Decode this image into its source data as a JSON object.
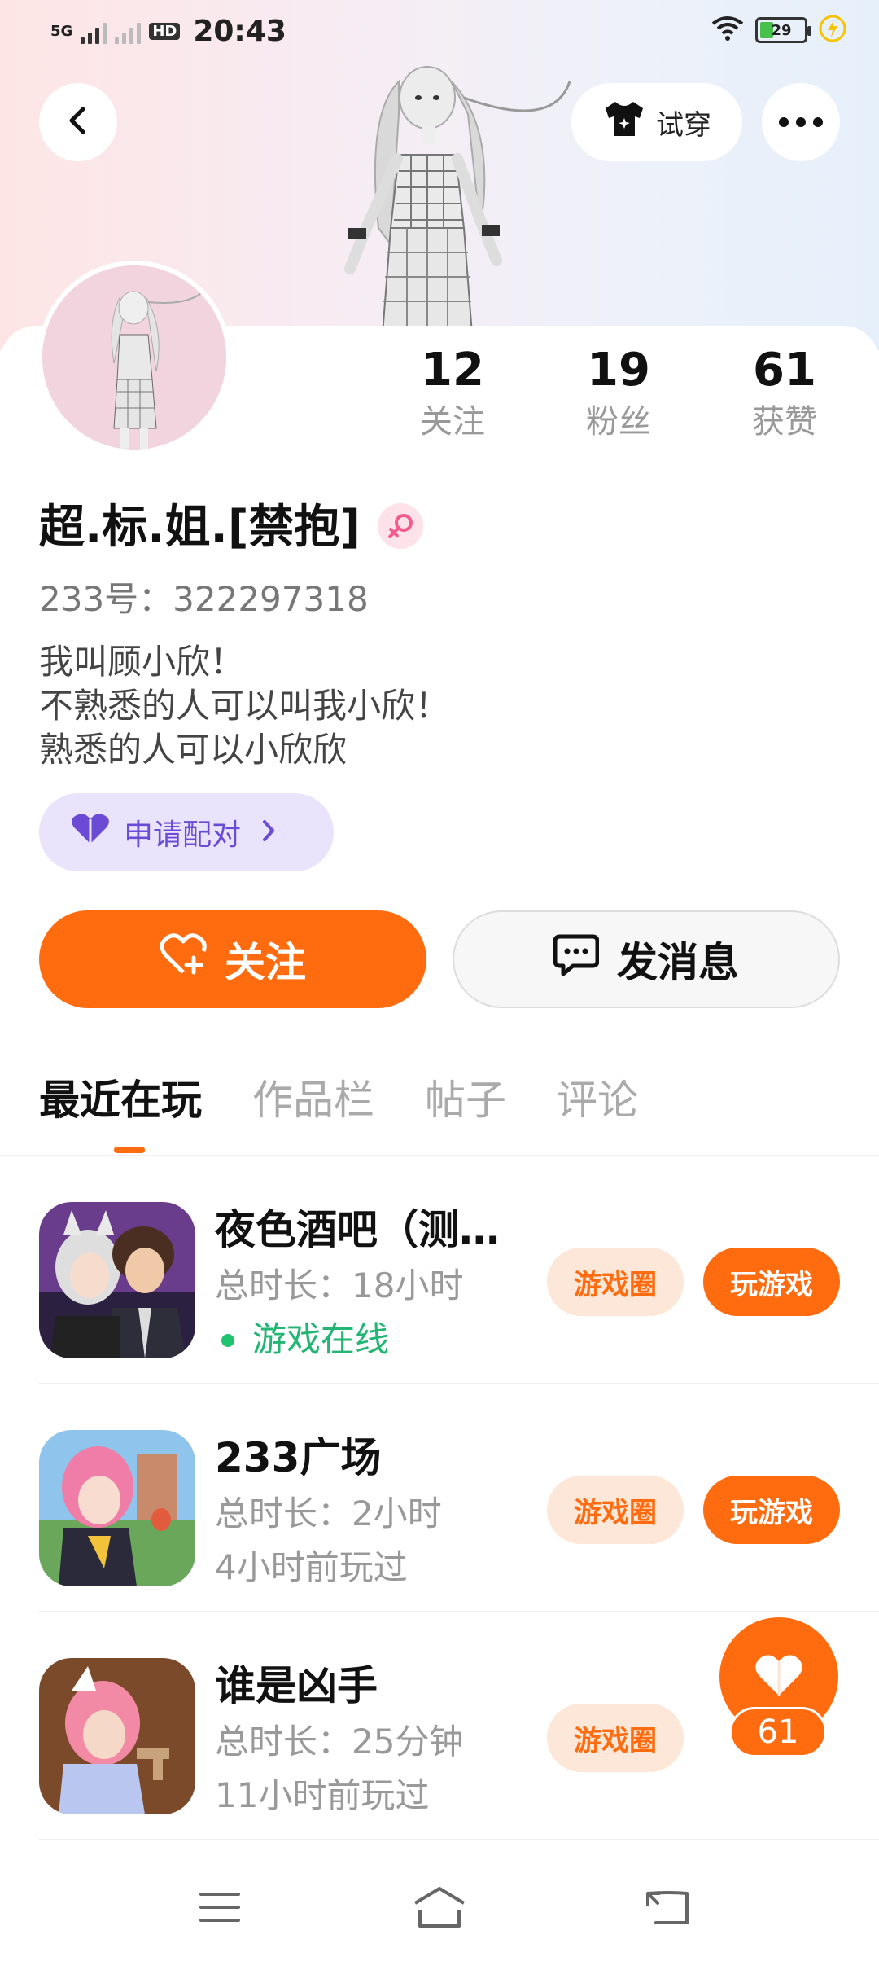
{
  "status_bar": {
    "network": "5G",
    "hd": "HD",
    "time": "20:43",
    "battery": "29",
    "battery_level": 0.29
  },
  "top_bar": {
    "back_icon": "chevron-left-icon",
    "tryon_label": "试穿",
    "tryon_icon": "tshirt-icon",
    "more_icon": "more-dots-icon"
  },
  "stats": [
    {
      "value": "12",
      "label": "关注"
    },
    {
      "value": "19",
      "label": "粉丝"
    },
    {
      "value": "61",
      "label": "获赞"
    }
  ],
  "profile": {
    "name": "超.标.姐.[禁抱]",
    "gender_icon": "female-icon",
    "id_text": "233号：322297318",
    "bio": [
      "我叫顾小欣！",
      "不熟悉的人可以叫我小欣！",
      "熟悉的人可以小欣欣"
    ],
    "pair_label": "申请配对",
    "pair_icon": "heart-icon"
  },
  "actions": {
    "follow_label": "关注",
    "message_label": "发消息"
  },
  "tabs": [
    "最近在玩",
    "作品栏",
    "帖子",
    "评论"
  ],
  "games": [
    {
      "title": "夜色酒吧（测…",
      "duration": "总时长：18小时",
      "status": "游戏在线",
      "circle_label": "游戏圈",
      "play_label": "玩游戏"
    },
    {
      "title": "233广场",
      "duration": "总时长：2小时",
      "status": "4小时前玩过",
      "circle_label": "游戏圈",
      "play_label": "玩游戏"
    },
    {
      "title": "谁是凶手",
      "duration": "总时长：25分钟",
      "status": "11小时前玩过",
      "circle_label": "游戏圈"
    }
  ],
  "like_fab": {
    "icon": "heart-icon",
    "count": "61"
  },
  "colors": {
    "accent": "#ff6b0f",
    "pair_bg": "#e9e4fb",
    "pair_text": "#6b4ad6",
    "online": "#22b573"
  },
  "bottom_nav": {
    "menu_icon": "menu-icon",
    "home_icon": "home-icon",
    "back_icon": "back-icon"
  }
}
